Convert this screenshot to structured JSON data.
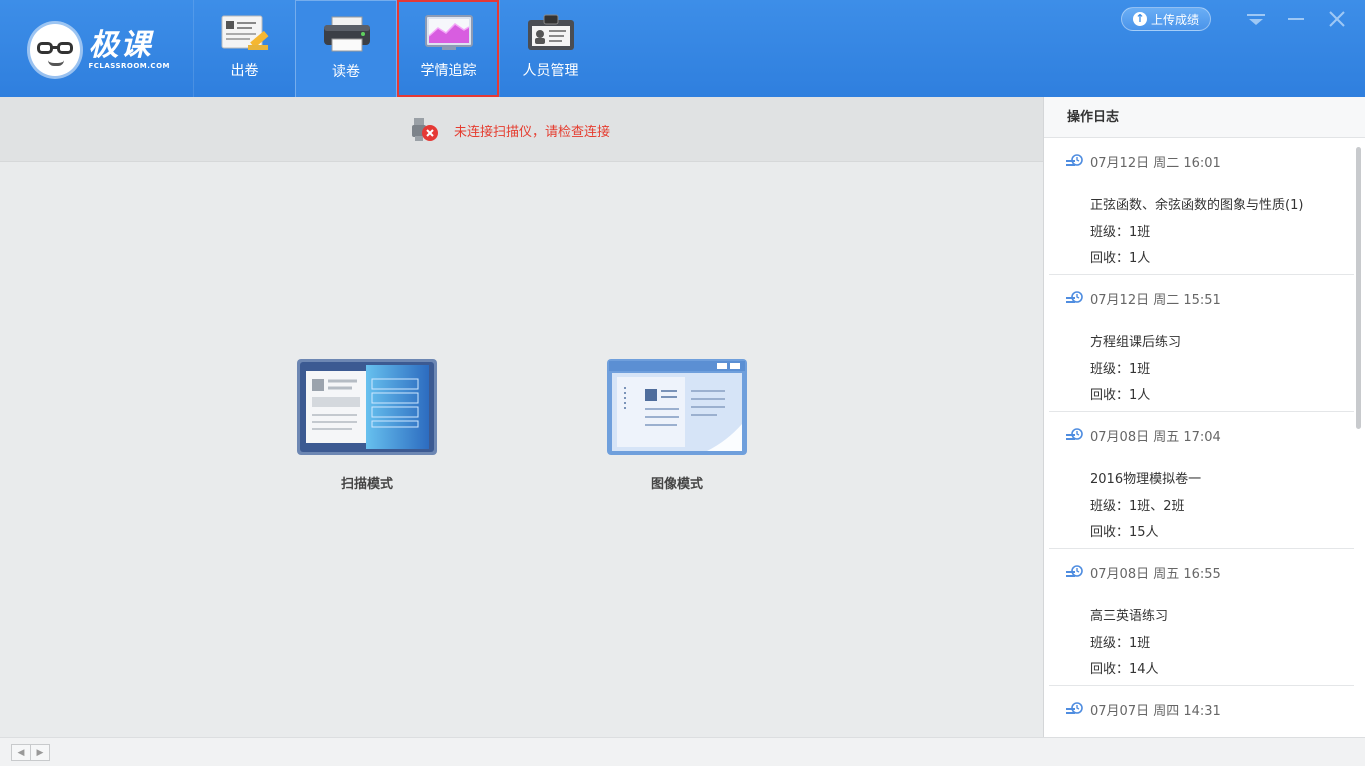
{
  "app": {
    "logo_text": "极课",
    "logo_subtext": "FCLASSROOM.COM"
  },
  "nav": [
    {
      "label": "出卷",
      "icon": "paper-pen-icon"
    },
    {
      "label": "读卷",
      "icon": "printer-icon"
    },
    {
      "label": "学情追踪",
      "icon": "chart-icon"
    },
    {
      "label": "人员管理",
      "icon": "id-card-icon"
    }
  ],
  "header": {
    "upload_label": "上传成绩"
  },
  "status": {
    "message": "未连接扫描仪，请检查连接",
    "color": "#e53d30"
  },
  "modes": {
    "scan_label": "扫描模式",
    "image_label": "图像模式"
  },
  "log": {
    "title": "操作日志",
    "entries": [
      {
        "time": "07月12日 周二 16:01",
        "name": "正弦函数、余弦函数的图象与性质(1)",
        "class": "班级：1班",
        "recv": "回收：1人"
      },
      {
        "time": "07月12日 周二 15:51",
        "name": "方程组课后练习",
        "class": "班级：1班",
        "recv": "回收：1人"
      },
      {
        "time": "07月08日 周五 17:04",
        "name": "2016物理模拟卷一",
        "class": "班级：1班、2班",
        "recv": "回收：15人"
      },
      {
        "time": "07月08日 周五 16:55",
        "name": "高三英语练习",
        "class": "班级：1班",
        "recv": "回收：14人"
      },
      {
        "time": "07月07日 周四 14:31",
        "name": "",
        "class": "",
        "recv": ""
      }
    ]
  },
  "colors": {
    "header_blue": "#3d8ee8",
    "error_red": "#e53d30"
  }
}
